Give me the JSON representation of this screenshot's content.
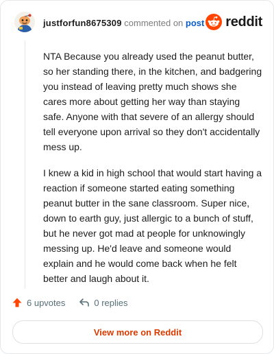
{
  "header": {
    "username": "justforfun8675309",
    "commented_on_text": "commented on",
    "post_link_label": "post",
    "brand_wordmark": "reddit",
    "brand_color": "#ff4500"
  },
  "comment": {
    "paragraphs": [
      "NTA Because you already used the peanut butter, so her standing there, in the kitchen, and badgering you instead of leaving pretty much shows she cares more about getting her way than staying safe. Anyone with that severe of an allergy should tell everyone upon arrival so they don't accidentally mess up.",
      "I knew a kid in high school that would start having a reaction if someone started eating something peanut butter in the sane classroom. Super nice, down to earth guy, just allergic to a bunch of stuff, but he never got mad at people for unknowingly messing up. He'd leave and someone would explain and he would come back when he felt better and laugh about it."
    ]
  },
  "actions": {
    "upvotes_label": "6 upvotes",
    "replies_label": "0 replies",
    "upvote_color": "#ff4500"
  },
  "footer": {
    "view_more_label": "View more on Reddit",
    "view_more_color": "#d93a00"
  },
  "icons": [
    "avatar-snoo-icon",
    "reddit-logo-icon",
    "upvote-arrow-icon",
    "reply-arrow-icon"
  ]
}
